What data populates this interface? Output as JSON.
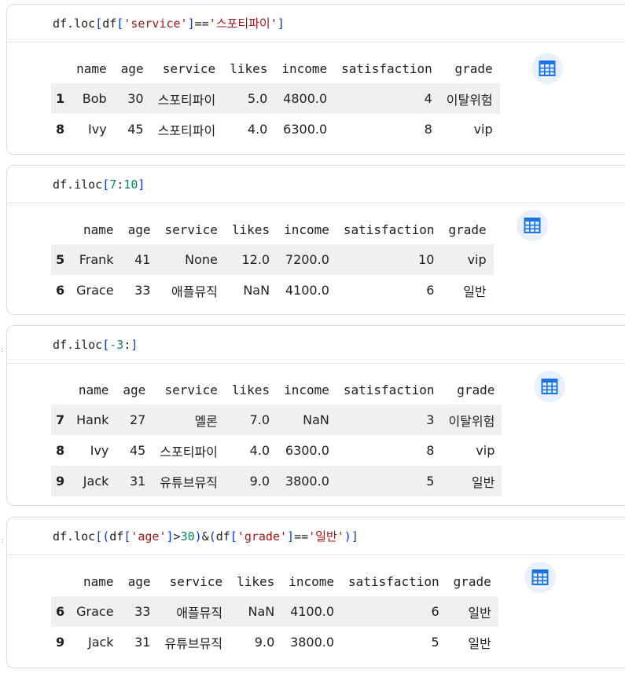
{
  "cells": [
    {
      "code": [
        {
          "t": "df.loc",
          "c": "p"
        },
        {
          "t": "[",
          "c": "br"
        },
        {
          "t": "df",
          "c": "p"
        },
        {
          "t": "[",
          "c": "br"
        },
        {
          "t": "'service'",
          "c": "s"
        },
        {
          "t": "]",
          "c": "br"
        },
        {
          "t": "==",
          "c": "p"
        },
        {
          "t": "'스포티파이'",
          "c": "s"
        },
        {
          "t": "]",
          "c": "br"
        }
      ],
      "columns": [
        "name",
        "age",
        "service",
        "likes",
        "income",
        "satisfaction",
        "grade"
      ],
      "rows": [
        [
          "1",
          "Bob",
          "30",
          "스포티파이",
          "5.0",
          "4800.0",
          "4",
          "이탈위험"
        ],
        [
          "8",
          "Ivy",
          "45",
          "스포티파이",
          "4.0",
          "6300.0",
          "8",
          "vip"
        ]
      ]
    },
    {
      "code": [
        {
          "t": "df.iloc",
          "c": "p"
        },
        {
          "t": "[",
          "c": "br"
        },
        {
          "t": "7",
          "c": "n"
        },
        {
          "t": ":",
          "c": "p"
        },
        {
          "t": "10",
          "c": "n"
        },
        {
          "t": "]",
          "c": "br"
        }
      ],
      "columns": [
        "name",
        "age",
        "service",
        "likes",
        "income",
        "satisfaction",
        "grade"
      ],
      "rows": [
        [
          "5",
          "Frank",
          "41",
          "None",
          "12.0",
          "7200.0",
          "10",
          "vip"
        ],
        [
          "6",
          "Grace",
          "33",
          "애플뮤직",
          "NaN",
          "4100.0",
          "6",
          "일반"
        ]
      ]
    },
    {
      "code": [
        {
          "t": "df.iloc",
          "c": "p"
        },
        {
          "t": "[",
          "c": "br"
        },
        {
          "t": "-3",
          "c": "n"
        },
        {
          "t": ":",
          "c": "p"
        },
        {
          "t": "]",
          "c": "br"
        }
      ],
      "columns": [
        "name",
        "age",
        "service",
        "likes",
        "income",
        "satisfaction",
        "grade"
      ],
      "rows": [
        [
          "7",
          "Hank",
          "27",
          "멜론",
          "7.0",
          "NaN",
          "3",
          "이탈위험"
        ],
        [
          "8",
          "Ivy",
          "45",
          "스포티파이",
          "4.0",
          "6300.0",
          "8",
          "vip"
        ],
        [
          "9",
          "Jack",
          "31",
          "유튜브뮤직",
          "9.0",
          "3800.0",
          "5",
          "일반"
        ]
      ]
    },
    {
      "code": [
        {
          "t": "df.loc",
          "c": "p"
        },
        {
          "t": "[(",
          "c": "br"
        },
        {
          "t": "df",
          "c": "p"
        },
        {
          "t": "[",
          "c": "br"
        },
        {
          "t": "'age'",
          "c": "s"
        },
        {
          "t": "]",
          "c": "br"
        },
        {
          "t": ">",
          "c": "p"
        },
        {
          "t": "30",
          "c": "n"
        },
        {
          "t": ")",
          "c": "br"
        },
        {
          "t": "&",
          "c": "p"
        },
        {
          "t": "(",
          "c": "br"
        },
        {
          "t": "df",
          "c": "p"
        },
        {
          "t": "[",
          "c": "br"
        },
        {
          "t": "'grade'",
          "c": "s"
        },
        {
          "t": "]",
          "c": "br"
        },
        {
          "t": "==",
          "c": "p"
        },
        {
          "t": "'일반'",
          "c": "s"
        },
        {
          "t": ")]",
          "c": "br"
        }
      ],
      "columns": [
        "name",
        "age",
        "service",
        "likes",
        "income",
        "satisfaction",
        "grade"
      ],
      "rows": [
        [
          "6",
          "Grace",
          "33",
          "애플뮤직",
          "NaN",
          "4100.0",
          "6",
          "일반"
        ],
        [
          "9",
          "Jack",
          "31",
          "유튜브뮤직",
          "9.0",
          "3800.0",
          "5",
          "일반"
        ]
      ]
    }
  ],
  "table_button": {
    "icon": "table-grid-icon",
    "color": "#1a73e8"
  },
  "margin_marker": ":",
  "colors": {
    "string": "#a31515",
    "bracket": "#0431fa",
    "number": "#098658",
    "row_stripe": "#f0f0f0"
  }
}
